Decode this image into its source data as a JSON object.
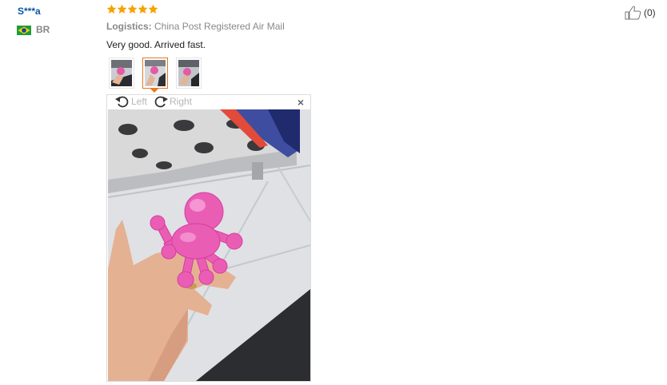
{
  "reviewer": {
    "name": "S***a",
    "country_code": "BR",
    "flag_icon": "brazil-flag-icon"
  },
  "review": {
    "rating": 5,
    "rating_max": 5,
    "logistics_label": "Logistics:",
    "logistics_value": "China Post Registered Air Mail",
    "text": "Very good. Arrived fast."
  },
  "helpful": {
    "icon": "thumbs-up-icon",
    "count": "(0)"
  },
  "thumbnails": {
    "count": 3,
    "active_index": 1
  },
  "viewer": {
    "rotate_left_label": "Left",
    "rotate_right_label": "Right",
    "close_label": "×"
  },
  "colors": {
    "name_blue": "#0a56a6",
    "star_orange": "#f6a200",
    "active_border": "#e8771d",
    "muted_text": "#888888"
  }
}
